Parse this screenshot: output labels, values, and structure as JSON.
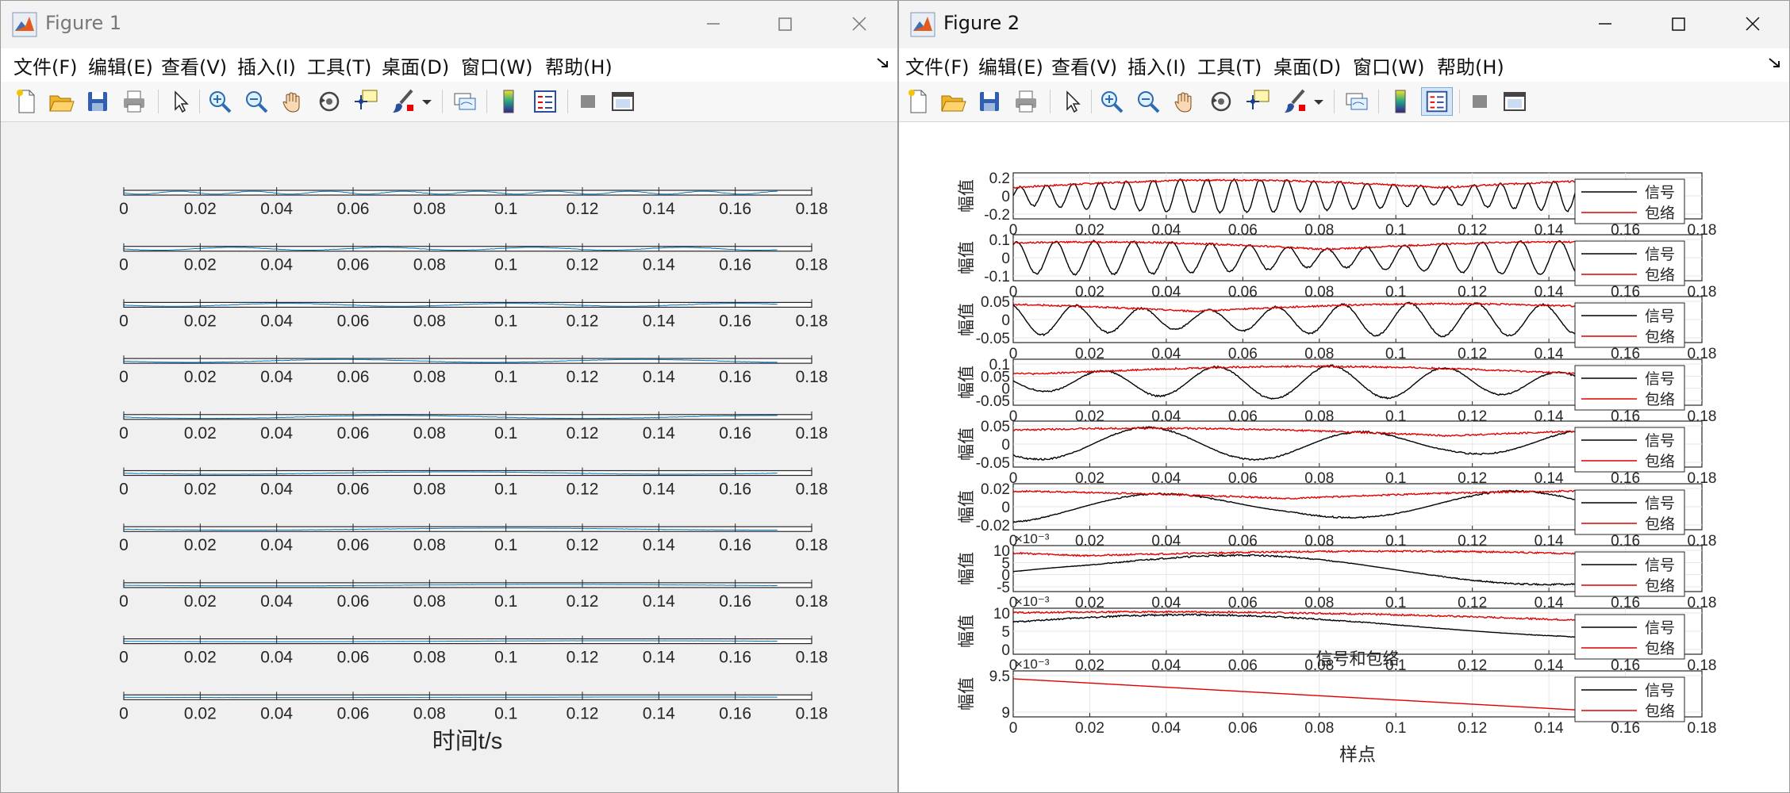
{
  "figure1": {
    "title": "Figure 1",
    "xlabel": "时间t/s",
    "xticks": [
      "0",
      "0.02",
      "0.04",
      "0.06",
      "0.08",
      "0.1",
      "0.12",
      "0.14",
      "0.16",
      "0.18"
    ],
    "subplot_count": 10
  },
  "figure2": {
    "title": "Figure 2",
    "xlabel": "样点",
    "overlay_title": "信号和包络",
    "ylabel": "幅值",
    "xticks": [
      "0",
      "0.02",
      "0.04",
      "0.06",
      "0.08",
      "0.1",
      "0.12",
      "0.14",
      "0.16",
      "0.18"
    ],
    "legend": [
      "信号",
      "包络"
    ],
    "subplots": [
      {
        "yticks": [
          "0.2",
          "0",
          "-0.2"
        ],
        "exponent": ""
      },
      {
        "yticks": [
          "0.1",
          "0",
          "-0.1"
        ],
        "exponent": ""
      },
      {
        "yticks": [
          "0.05",
          "0",
          "-0.05"
        ],
        "exponent": ""
      },
      {
        "yticks": [
          "0.1",
          "0.05",
          "0",
          "-0.05"
        ],
        "exponent": ""
      },
      {
        "yticks": [
          "0.05",
          "0",
          "-0.05"
        ],
        "exponent": ""
      },
      {
        "yticks": [
          "0.02",
          "0",
          "-0.02"
        ],
        "exponent": ""
      },
      {
        "yticks": [
          "10",
          "5",
          "0",
          "-5"
        ],
        "exponent": "×10⁻³"
      },
      {
        "yticks": [
          "10",
          "5",
          "0"
        ],
        "exponent": "×10⁻³"
      },
      {
        "yticks": [
          "9.5",
          "9"
        ],
        "exponent": "×10⁻³"
      }
    ]
  },
  "menu": [
    "文件(F)",
    "编辑(E)",
    "查看(V)",
    "插入(I)",
    "工具(T)",
    "桌面(D)",
    "窗口(W)",
    "帮助(H)"
  ],
  "colors": {
    "signal": "#000000",
    "envelope": "#e00000",
    "fig1_line": "#0072bd",
    "grid": "#e6e6e6"
  }
}
